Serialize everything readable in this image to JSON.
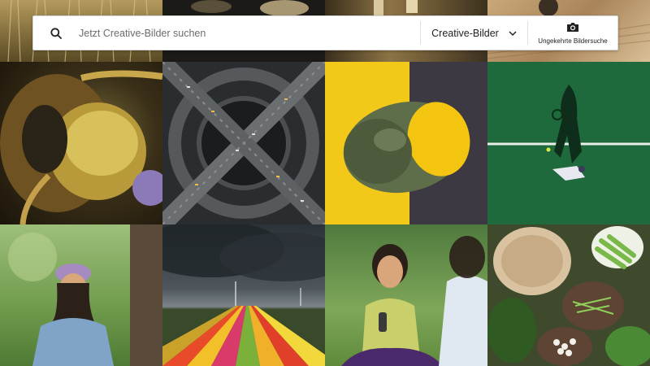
{
  "search": {
    "placeholder": "Jetzt Creative-Bilder suchen",
    "value": ""
  },
  "filter": {
    "selected": "Creative-Bilder"
  },
  "reverse_search": {
    "label": "Ungekehrte Bildersuche"
  },
  "icons": {
    "search": "search-icon",
    "dropdown": "chevron-down-icon",
    "camera": "camera-icon"
  },
  "colors": {
    "lemon_yellow": "#f2c919",
    "tennis_green": "#1e6a3c",
    "search_bg": "#ffffff"
  }
}
